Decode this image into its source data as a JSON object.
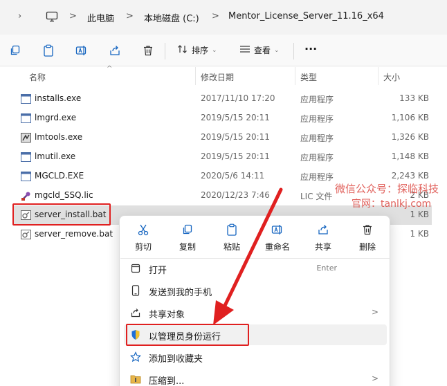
{
  "breadcrumb": {
    "items": [
      "此电脑",
      "本地磁盘 (C:)",
      "Mentor_License_Server_11.16_x64"
    ],
    "separator": ">"
  },
  "toolbar": {
    "sort_label": "排序",
    "view_label": "查看",
    "more_label": "···",
    "icons": [
      "copy-icon",
      "paste-icon",
      "rename-icon",
      "share-icon",
      "delete-icon"
    ]
  },
  "columns": {
    "name": "名称",
    "date": "修改日期",
    "type": "类型",
    "size": "大小"
  },
  "files": [
    {
      "name": "installs.exe",
      "date": "2017/11/10 17:20",
      "type": "应用程序",
      "size": "133 KB",
      "icon": "exe-icon"
    },
    {
      "name": "lmgrd.exe",
      "date": "2019/5/15 20:11",
      "type": "应用程序",
      "size": "1,106 KB",
      "icon": "exe-icon"
    },
    {
      "name": "lmtools.exe",
      "date": "2019/5/15 20:11",
      "type": "应用程序",
      "size": "1,326 KB",
      "icon": "lmtools-icon"
    },
    {
      "name": "lmutil.exe",
      "date": "2019/5/15 20:11",
      "type": "应用程序",
      "size": "1,148 KB",
      "icon": "exe-icon"
    },
    {
      "name": "MGCLD.EXE",
      "date": "2020/5/6 14:11",
      "type": "应用程序",
      "size": "2,243 KB",
      "icon": "exe-icon"
    },
    {
      "name": "mgcld_SSQ.lic",
      "date": "2020/12/23 7:46",
      "type": "LIC 文件",
      "size": "2 KB",
      "icon": "lic-icon"
    },
    {
      "name": "server_install.bat",
      "date": "",
      "type": "",
      "size": "1 KB",
      "icon": "bat-icon"
    },
    {
      "name": "server_remove.bat",
      "date": "",
      "type": "",
      "size": "1 KB",
      "icon": "bat-icon"
    }
  ],
  "watermark": {
    "line1": "微信公众号：探临科技",
    "line2": "官网：tanlkj.com"
  },
  "context_menu": {
    "quick_actions": [
      {
        "label": "剪切",
        "icon": "cut-icon"
      },
      {
        "label": "复制",
        "icon": "copy-icon"
      },
      {
        "label": "粘贴",
        "icon": "paste-icon"
      },
      {
        "label": "重命名",
        "icon": "rename-icon"
      },
      {
        "label": "共享",
        "icon": "share-icon"
      },
      {
        "label": "删除",
        "icon": "delete-icon"
      }
    ],
    "items": [
      {
        "label": "打开",
        "shortcut": "Enter",
        "icon": "open-icon"
      },
      {
        "label": "发送到我的手机",
        "icon": "phone-icon"
      },
      {
        "label": "共享对象",
        "icon": "share-icon",
        "submenu": true
      },
      {
        "label": "以管理员身份运行",
        "icon": "shield-icon"
      },
      {
        "label": "添加到收藏夹",
        "icon": "star-icon"
      },
      {
        "label": "压缩到...",
        "icon": "zip-icon",
        "submenu": true
      }
    ],
    "submenu_arrow": ">"
  },
  "colors": {
    "highlight_red": "#e02020",
    "accent_blue": "#1565c0"
  }
}
